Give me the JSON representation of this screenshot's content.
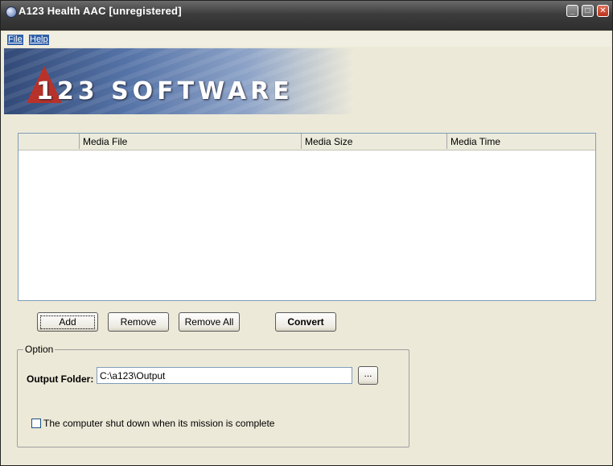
{
  "window": {
    "title": "A123 Health AAC  [unregistered]",
    "minimize_glyph": "_",
    "maximize_glyph": "□",
    "close_glyph": "✕"
  },
  "menu": [
    {
      "label": "File"
    },
    {
      "label": "Help"
    }
  ],
  "banner": {
    "logo_text": "123 SOFTWARE"
  },
  "file_list": {
    "columns": [
      "",
      "Media File",
      "Media Size",
      "Media Time"
    ],
    "rows": []
  },
  "buttons": {
    "add": "Add",
    "remove": "Remove",
    "remove_all": "Remove All",
    "convert": "Convert"
  },
  "option": {
    "group_label": "Option",
    "output_folder_label": "Output Folder:",
    "output_folder_value": "C:\\a123\\Output",
    "browse_label": "...",
    "shutdown_label": "The computer shut down when its mission is complete",
    "shutdown_checked": false
  },
  "colors": {
    "titlebar": "#3c3c3c",
    "window_bg": "#ece9d8",
    "menu_highlight": "#2f5fa8",
    "close_button": "#c0391f"
  }
}
